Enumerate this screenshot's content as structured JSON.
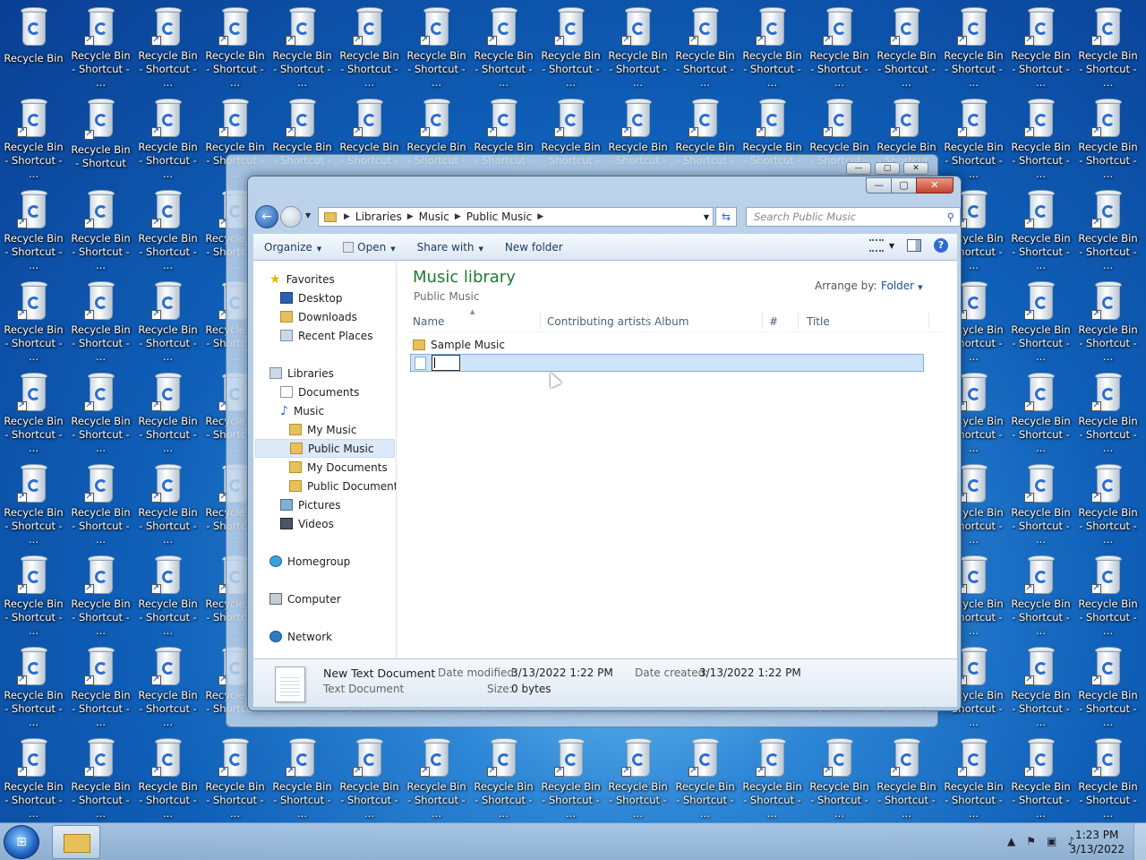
{
  "desktop": {
    "first_icon_label": "Recycle Bin",
    "shortcut_label": "Recycle Bin - Shortcut - ...",
    "shortcut_label_short": "Recycle Bin - Shortcut"
  },
  "window": {
    "caption_buttons": {
      "minimize": "—",
      "maximize": "▢",
      "close": "✕"
    },
    "breadcrumbs": [
      "Libraries",
      "Music",
      "Public Music"
    ],
    "search_placeholder": "Search Public Music",
    "toolbar": {
      "organize": "Organize",
      "open": "Open",
      "share_with": "Share with",
      "new_folder": "New folder"
    },
    "nav_pane": {
      "favorites": "Favorites",
      "favorites_items": [
        "Desktop",
        "Downloads",
        "Recent Places"
      ],
      "libraries": "Libraries",
      "documents": "Documents",
      "music": "Music",
      "music_items": [
        "My Music",
        "Public Music",
        "My Documents",
        "Public Documents"
      ],
      "pictures": "Pictures",
      "videos": "Videos",
      "homegroup": "Homegroup",
      "computer": "Computer",
      "network": "Network",
      "selected": "Public Music"
    },
    "content": {
      "title": "Music library",
      "subtitle": "Public Music",
      "arrange_label": "Arrange by:",
      "arrange_value": "Folder",
      "columns": [
        "Name",
        "Contributing artists",
        "Album",
        "#",
        "Title"
      ],
      "items": [
        {
          "name": "Sample Music",
          "type": "folder"
        }
      ],
      "renaming_value": ""
    },
    "details": {
      "name": "New Text Document",
      "type": "Text Document",
      "date_modified_label": "Date modified:",
      "date_modified": "3/13/2022 1:22 PM",
      "date_created_label": "Date created:",
      "date_created": "3/13/2022 1:22 PM",
      "size_label": "Size:",
      "size": "0 bytes"
    }
  },
  "taskbar": {
    "time": "1:23 PM",
    "date": "3/13/2022"
  },
  "colors": {
    "library_title": "#1e7a2f",
    "selection": "#cde3fa",
    "close_button": "#c6412b"
  }
}
